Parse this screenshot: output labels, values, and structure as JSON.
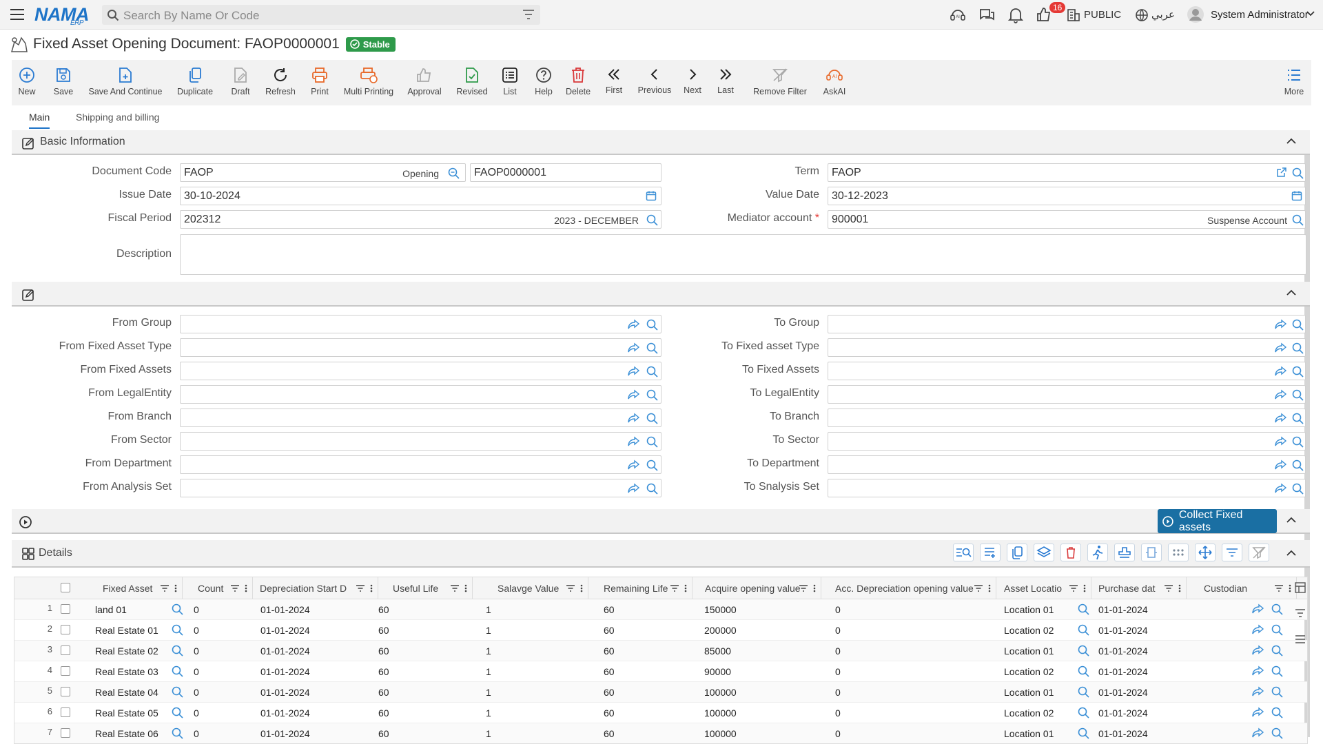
{
  "header": {
    "logo_text": "NAMA",
    "logo_sub": "ERP",
    "search_placeholder": "Search By Name Or Code",
    "notifications_count": "16",
    "company": "PUBLIC",
    "language": "عربي",
    "user": "System Administrator"
  },
  "document": {
    "title": "Fixed Asset Opening Document: FAOP0000001",
    "status": "Stable"
  },
  "toolbar": {
    "new": "New",
    "save": "Save",
    "save_continue": "Save And Continue",
    "duplicate": "Duplicate",
    "draft": "Draft",
    "refresh": "Refresh",
    "print": "Print",
    "multi_printing": "Multi Printing",
    "approval": "Approval",
    "revised": "Revised",
    "list": "List",
    "help": "Help",
    "delete": "Delete",
    "first": "First",
    "previous": "Previous",
    "next": "Next",
    "last": "Last",
    "remove_filter": "Remove Filter",
    "askai": "AskAI",
    "more": "More"
  },
  "tabs": {
    "main": "Main",
    "shipping": "Shipping and billing"
  },
  "basic": {
    "section_title": "Basic Information",
    "document_code_label": "Document Code",
    "document_code": "FAOP",
    "document_code_tag": "Opening",
    "document_number": "FAOP0000001",
    "term_label": "Term",
    "term": "FAOP",
    "issue_date_label": "Issue Date",
    "issue_date": "30-10-2024",
    "value_date_label": "Value Date",
    "value_date": "30-12-2023",
    "fiscal_period_label": "Fiscal Period",
    "fiscal_period": "202312",
    "fiscal_period_tag": "2023 - DECEMBER",
    "mediator_label": "Mediator account",
    "mediator_required": "*",
    "mediator": "900001",
    "mediator_tag": "Suspense Account",
    "description_label": "Description"
  },
  "filters": {
    "left": [
      "From Group",
      "From Fixed Asset Type",
      "From Fixed Assets",
      "From LegalEntity",
      "From Branch",
      "From Sector",
      "From Department",
      "From Analysis Set"
    ],
    "right": [
      "To Group",
      "To Fixed asset Type",
      "To Fixed Assets",
      "To LegalEntity",
      "To Branch",
      "To Sector",
      "To Department",
      "To Snalysis Set"
    ]
  },
  "collect_button": "Collect Fixed assets",
  "details": {
    "section_title": "Details",
    "columns": [
      "Fixed Asset",
      "Count",
      "Depreciation Start D",
      "Useful Life",
      "Salavge Value",
      "Remaining Life",
      "Acquire opening value",
      "Acc. Depreciation opening value",
      "Asset Locatio",
      "Purchase dat",
      "Custodian"
    ],
    "rows": [
      {
        "n": "1",
        "asset": "land 01",
        "count": "0",
        "dep_start": "01-01-2024",
        "life": "60",
        "salvage": "1",
        "remaining": "60",
        "acquire": "150000",
        "acc_dep": "0",
        "location": "Location 01",
        "purchase": "01-01-2024"
      },
      {
        "n": "2",
        "asset": "Real Estate 01",
        "count": "0",
        "dep_start": "01-01-2024",
        "life": "60",
        "salvage": "1",
        "remaining": "60",
        "acquire": "200000",
        "acc_dep": "0",
        "location": "Location 02",
        "purchase": "01-01-2024"
      },
      {
        "n": "3",
        "asset": "Real Estate 02",
        "count": "0",
        "dep_start": "01-01-2024",
        "life": "60",
        "salvage": "1",
        "remaining": "60",
        "acquire": "85000",
        "acc_dep": "0",
        "location": "Location 01",
        "purchase": "01-01-2024"
      },
      {
        "n": "4",
        "asset": "Real Estate 03",
        "count": "0",
        "dep_start": "01-01-2024",
        "life": "60",
        "salvage": "1",
        "remaining": "60",
        "acquire": "90000",
        "acc_dep": "0",
        "location": "Location 02",
        "purchase": "01-01-2024"
      },
      {
        "n": "5",
        "asset": "Real Estate 04",
        "count": "0",
        "dep_start": "01-01-2024",
        "life": "60",
        "salvage": "1",
        "remaining": "60",
        "acquire": "100000",
        "acc_dep": "0",
        "location": "Location 01",
        "purchase": "01-01-2024"
      },
      {
        "n": "6",
        "asset": "Real Estate 05",
        "count": "0",
        "dep_start": "01-01-2024",
        "life": "60",
        "salvage": "1",
        "remaining": "60",
        "acquire": "100000",
        "acc_dep": "0",
        "location": "Location 02",
        "purchase": "01-01-2024"
      },
      {
        "n": "7",
        "asset": "Real Estate 06",
        "count": "0",
        "dep_start": "01-01-2024",
        "life": "60",
        "salvage": "1",
        "remaining": "60",
        "acquire": "100000",
        "acc_dep": "0",
        "location": "Location 01",
        "purchase": "01-01-2024"
      }
    ]
  },
  "colors": {
    "accent": "#1e74c8",
    "status_green": "#2e9a4a",
    "collect": "#1a6fa3",
    "danger": "#e53935"
  }
}
